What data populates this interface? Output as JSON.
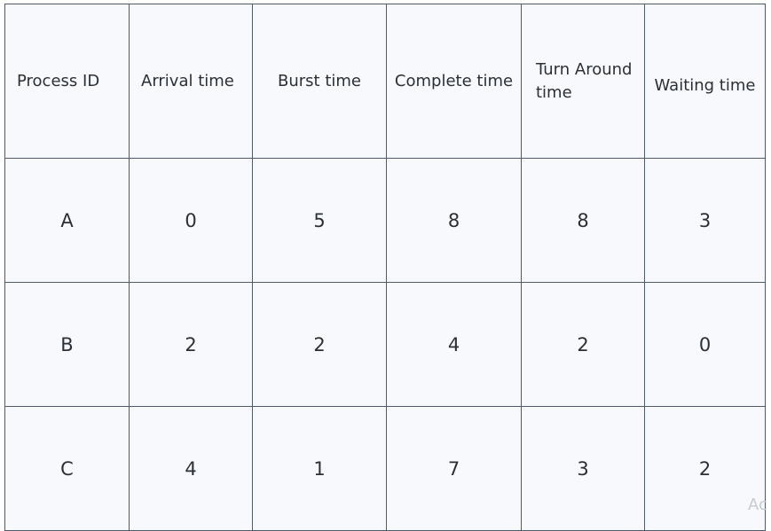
{
  "table": {
    "headers": [
      "Process ID",
      "Arrival time",
      "Burst time",
      "Complete time",
      "Turn Around time",
      "Waiting time"
    ],
    "rows": [
      [
        "A",
        "0",
        "5",
        "8",
        "8",
        "3"
      ],
      [
        "B",
        "2",
        "2",
        "4",
        "2",
        "0"
      ],
      [
        "C",
        "4",
        "1",
        "7",
        "3",
        "2"
      ]
    ]
  },
  "watermark": {
    "text": "Ac"
  },
  "colors": {
    "cell_background": "#f7f9fc",
    "border": "#4f5a6b",
    "text": "#2b2f36"
  }
}
